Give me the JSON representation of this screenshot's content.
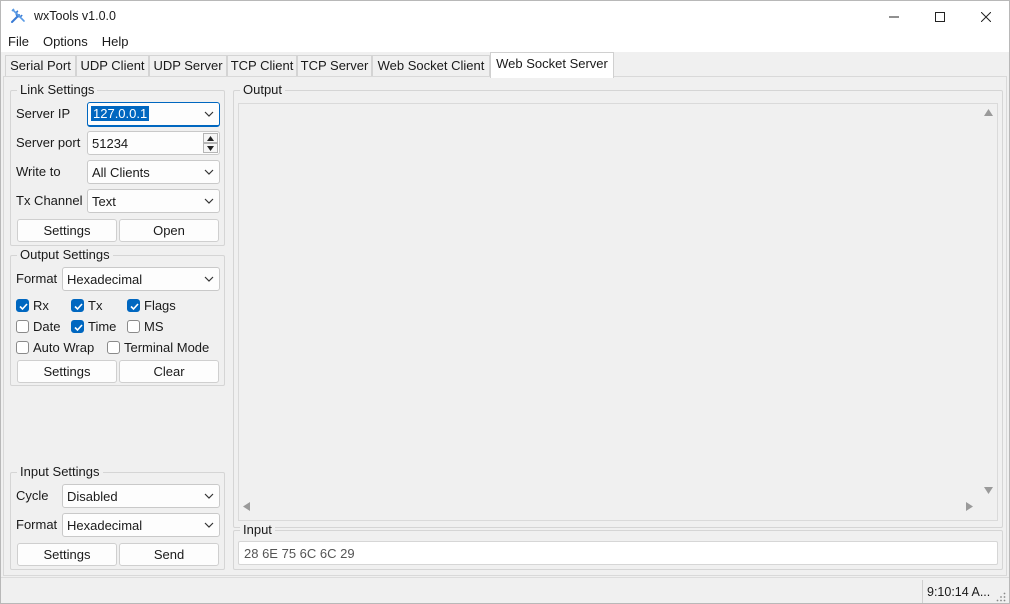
{
  "window": {
    "title": "wxTools v1.0.0"
  },
  "menu": [
    "File",
    "Options",
    "Help"
  ],
  "tabs": [
    "Serial Port",
    "UDP Client",
    "UDP Server",
    "TCP Client",
    "TCP Server",
    "Web Socket Client",
    "Web Socket Server"
  ],
  "active_tab": "Web Socket Server",
  "link": {
    "title": "Link Settings",
    "server_ip_label": "Server IP",
    "server_ip": "127.0.0.1",
    "server_port_label": "Server port",
    "server_port": "51234",
    "write_to_label": "Write to",
    "write_to": "All Clients",
    "tx_channel_label": "Tx Channel",
    "tx_channel": "Text",
    "settings_btn": "Settings",
    "open_btn": "Open"
  },
  "output_settings": {
    "title": "Output Settings",
    "format_label": "Format",
    "format": "Hexadecimal",
    "checks": {
      "rx": {
        "label": "Rx",
        "checked": true
      },
      "tx": {
        "label": "Tx",
        "checked": true
      },
      "flags": {
        "label": "Flags",
        "checked": true
      },
      "date": {
        "label": "Date",
        "checked": false
      },
      "time": {
        "label": "Time",
        "checked": true
      },
      "ms": {
        "label": "MS",
        "checked": false
      },
      "auto_wrap": {
        "label": "Auto Wrap",
        "checked": false
      },
      "terminal_mode": {
        "label": "Terminal Mode",
        "checked": false
      }
    },
    "settings_btn": "Settings",
    "clear_btn": "Clear"
  },
  "input_settings": {
    "title": "Input Settings",
    "cycle_label": "Cycle",
    "cycle": "Disabled",
    "format_label": "Format",
    "format": "Hexadecimal",
    "settings_btn": "Settings",
    "send_btn": "Send"
  },
  "output": {
    "title": "Output"
  },
  "input": {
    "title": "Input",
    "value": "28 6E 75 6C 6C 29"
  },
  "status": {
    "time": "9:10:14 A..."
  },
  "colors": {
    "accent": "#0067c0",
    "background": "#f0f0f0"
  }
}
